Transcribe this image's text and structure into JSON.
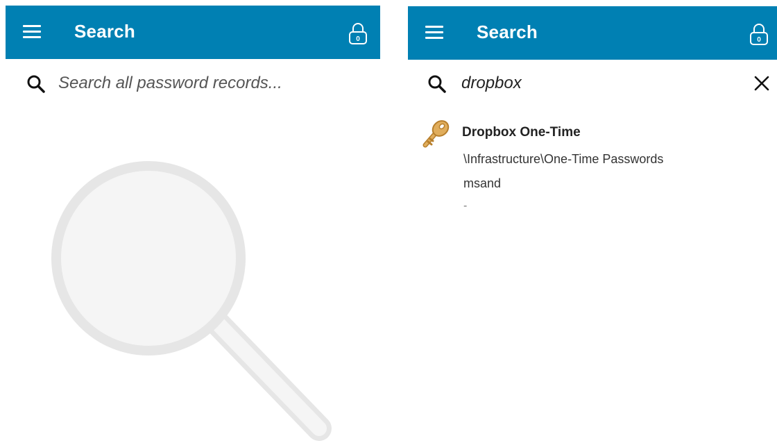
{
  "colors": {
    "appbar": "#0080b3",
    "illustration": "#e6e6e6",
    "key": "#e0ad5c"
  },
  "left": {
    "appbar": {
      "title": "Search",
      "menu_icon": "hamburger-icon",
      "lock_icon": "lock-icon",
      "lock_badge": "0"
    },
    "search": {
      "icon": "search-icon",
      "placeholder": "Search all password records...",
      "value": ""
    },
    "empty_state_icon": "magnifier-illustration"
  },
  "right": {
    "appbar": {
      "title": "Search",
      "menu_icon": "hamburger-icon",
      "lock_icon": "lock-icon",
      "lock_badge": "0"
    },
    "search": {
      "icon": "search-icon",
      "value": "dropbox",
      "clear_icon": "close-icon"
    },
    "results": [
      {
        "icon": "key-icon",
        "title": "Dropbox One-Time",
        "path": "\\Infrastructure\\One-Time Passwords",
        "username": "msand",
        "extra": "-"
      }
    ]
  }
}
